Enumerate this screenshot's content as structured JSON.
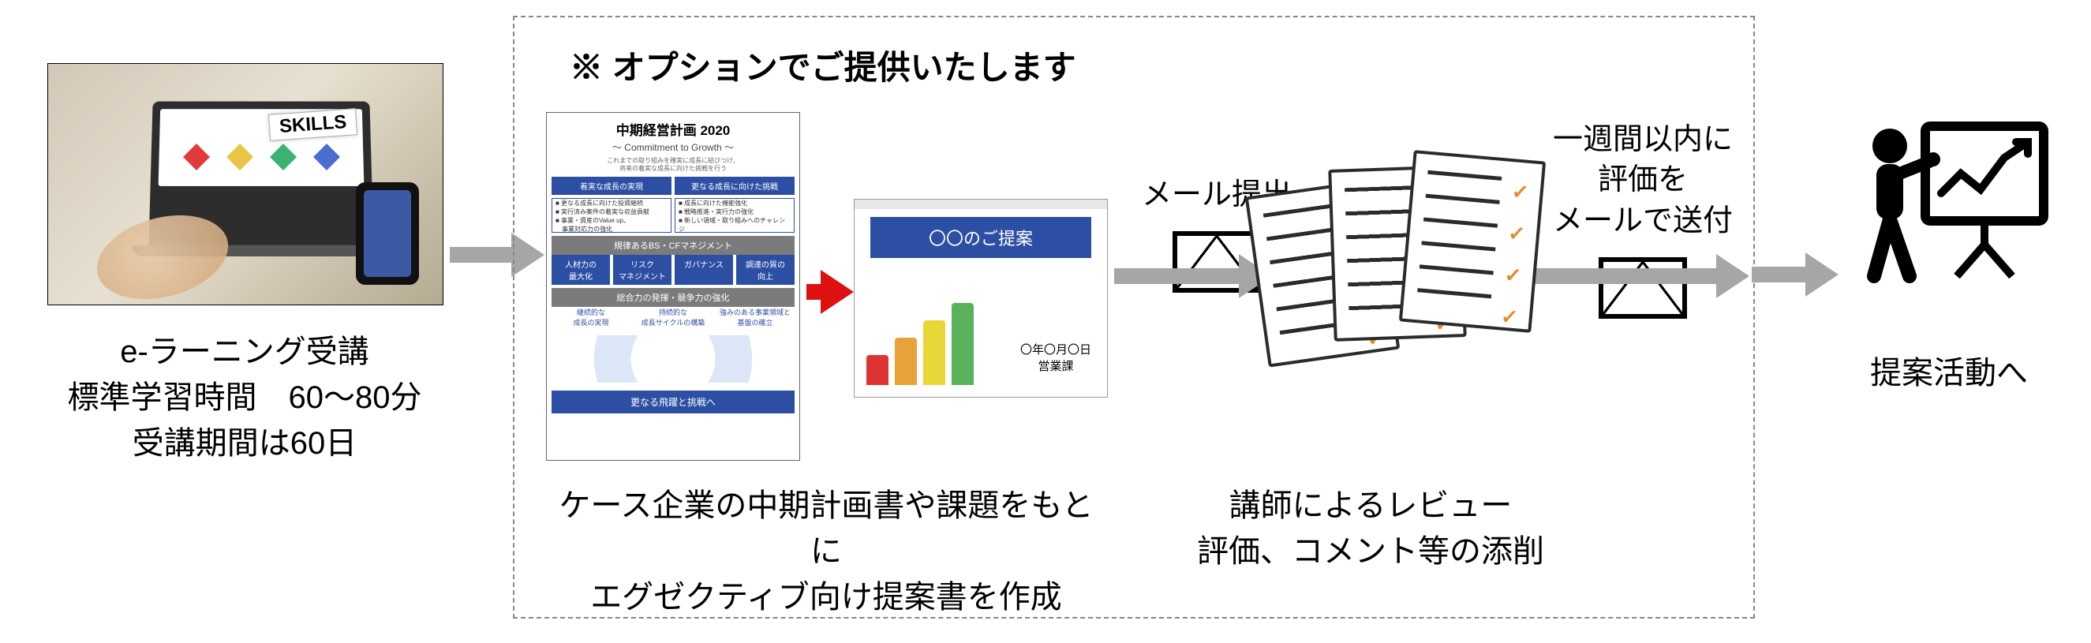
{
  "stage1": {
    "skills_tag": "SKILLS",
    "caption_l1": "e-ラーニング受講",
    "caption_l2": "標準学習時間　60～80分",
    "caption_l3": "受講期間は60日"
  },
  "option": {
    "title": "※ オプションでご提供いたします",
    "plan": {
      "title": "中期経営計画 2020",
      "subtitle": "～ Commitment to Growth ～",
      "mini1": "これまでの取り組みを確実に成長に結びつけ、",
      "mini2": "将来の着実な成長に向けた挑戦を行う",
      "bar_left": "着実な成長の実現",
      "bar_right": "更なる成長に向けた挑戦",
      "ul_left": "■ 更なる成長に向けた投資継続\n■ 実行済み案件の着実な収益貢献\n■ 事業・資産のValue up、\n　事業対応力の強化",
      "ul_right": "■ 成長に向けた機能強化\n■ 戦略推進・実行力の強化\n■ 新しい領域・取り組みへのチャレンジ",
      "graybar": "規律あるBS・CFマネジメント",
      "pill1": "人材力の\n最大化",
      "pill2": "リスク\nマネジメント",
      "pill3": "ガバナンス",
      "pill4": "調達の質の\n向上",
      "graybar2": "総合力の発揮・競争力の強化",
      "cycle1": "継続的な\n成長の実現",
      "cycle2": "持続的な\n成長サイクルの構築",
      "cycle3": "強みのある事業領域と\n基盤の確立",
      "footer": "更なる飛躍と挑戦へ"
    },
    "proposal": {
      "title": "〇〇のご提案",
      "date_l1": "〇年〇月〇日",
      "date_l2": "営業課"
    },
    "caption1_l1": "ケース企業の中期計画書や課題をもとに",
    "caption1_l2": "エグゼクティブ向け提案書を作成",
    "mail1": {
      "label": "メール提出"
    },
    "caption2_l1": "講師によるレビュー",
    "caption2_l2": "評価、コメント等の添削",
    "mail2": {
      "label_l1": "一週間以内に",
      "label_l2": "評価を",
      "label_l3": "メールで送付"
    }
  },
  "final": {
    "caption": "提案活動へ"
  },
  "icons": {
    "envelope": "envelope-icon",
    "presenter": "presenter-icon",
    "papers": "review-papers-icon",
    "arrow": "arrow-right-icon"
  }
}
